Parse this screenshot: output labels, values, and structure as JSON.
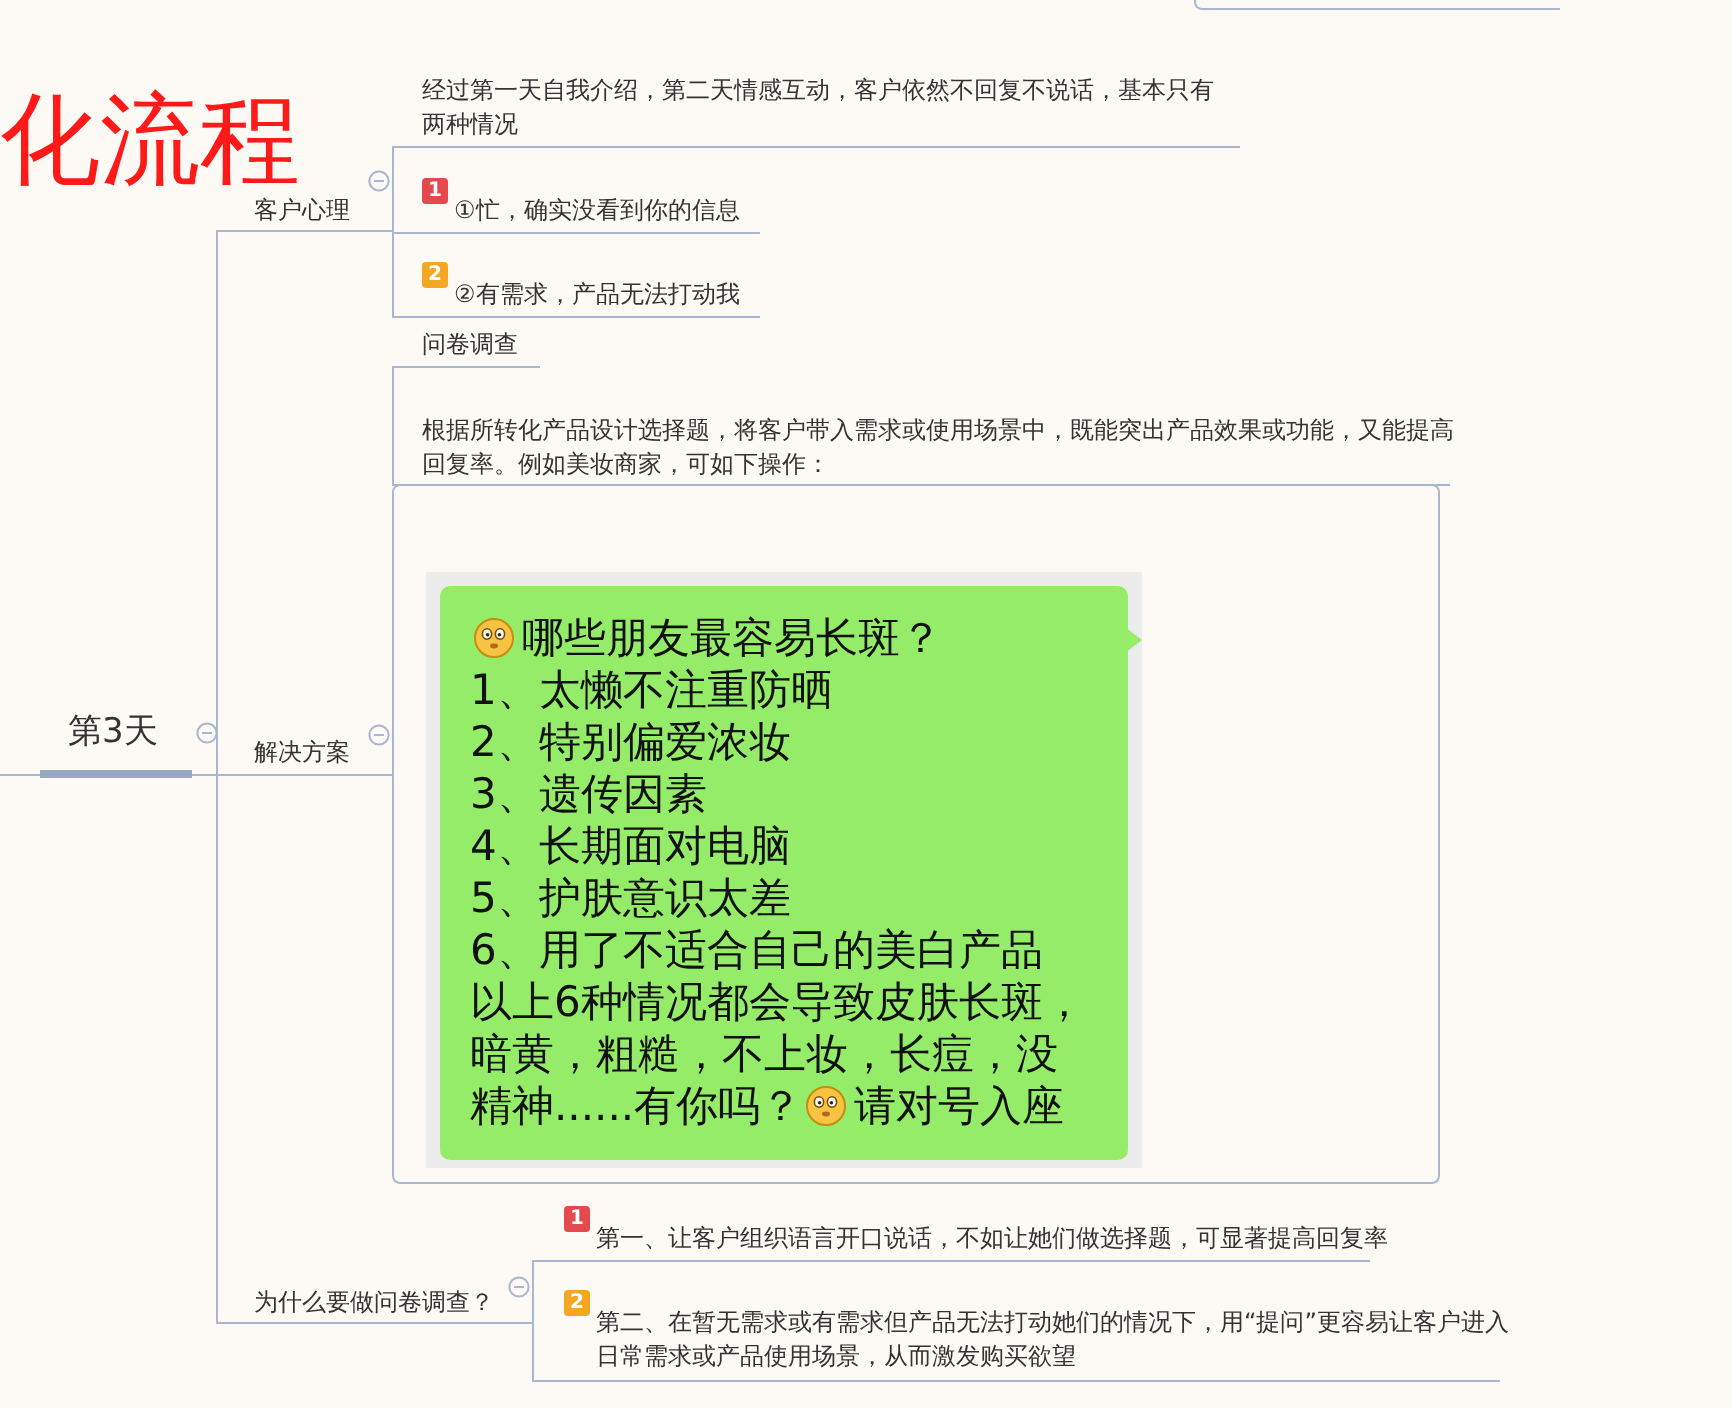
{
  "title": "化流程",
  "root": {
    "label": "第3天",
    "expanded": true,
    "branches": [
      {
        "label": "客户心理",
        "expanded": true,
        "children": [
          {
            "kind": "text",
            "text": "经过第一天自我介绍，第二天情感互动，客户依然不回复不说话，基本只有两种情况"
          },
          {
            "kind": "text",
            "badge": "1",
            "color": "#e5484d",
            "text": "①忙，确实没看到你的信息"
          },
          {
            "kind": "text",
            "badge": "2",
            "color": "#f5a623",
            "text": "②有需求，产品无法打动我"
          }
        ]
      },
      {
        "label": "解决方案",
        "expanded": true,
        "children": [
          {
            "kind": "text",
            "text": "问卷调查"
          },
          {
            "kind": "text",
            "text": "根据所转化产品设计选择题，将客户带入需求或使用场景中，既能突出产品效果或功能，又能提高回复率。例如美妆商家，可如下操作："
          },
          {
            "kind": "chat",
            "lines": [
              [
                {
                  "kind": "emoji"
                },
                {
                  "kind": "text",
                  "text": "哪些朋友最容易长斑？"
                }
              ],
              [
                {
                  "kind": "text",
                  "text": "1、太懒不注重防晒"
                }
              ],
              [
                {
                  "kind": "text",
                  "text": "2、特别偏爱浓妆"
                }
              ],
              [
                {
                  "kind": "text",
                  "text": "3、遗传因素"
                }
              ],
              [
                {
                  "kind": "text",
                  "text": "4、长期面对电脑"
                }
              ],
              [
                {
                  "kind": "text",
                  "text": "5、护肤意识太差"
                }
              ],
              [
                {
                  "kind": "text",
                  "text": "6、用了不适合自己的美白产品"
                }
              ],
              [
                {
                  "kind": "text",
                  "text": "以上6种情况都会导致皮肤长斑，暗黄，粗糙，不上妆，长痘，没精神......有你吗？"
                },
                {
                  "kind": "emoji"
                },
                {
                  "kind": "text",
                  "text": "请对号入座"
                }
              ]
            ]
          }
        ]
      },
      {
        "label": "为什么要做问卷调查？",
        "expanded": true,
        "children": [
          {
            "kind": "text",
            "badge": "1",
            "color": "#e5484d",
            "text": "第一、让客户组织语言开口说话，不如让她们做选择题，可显著提高回复率"
          },
          {
            "kind": "text",
            "badge": "2",
            "color": "#f5a623",
            "text": "第二、在暂无需求或有需求但产品无法打动她们的情况下，用“提问”更容易让客户进入日常需求或产品使用场景，从而激发购买欲望"
          }
        ]
      }
    ]
  }
}
